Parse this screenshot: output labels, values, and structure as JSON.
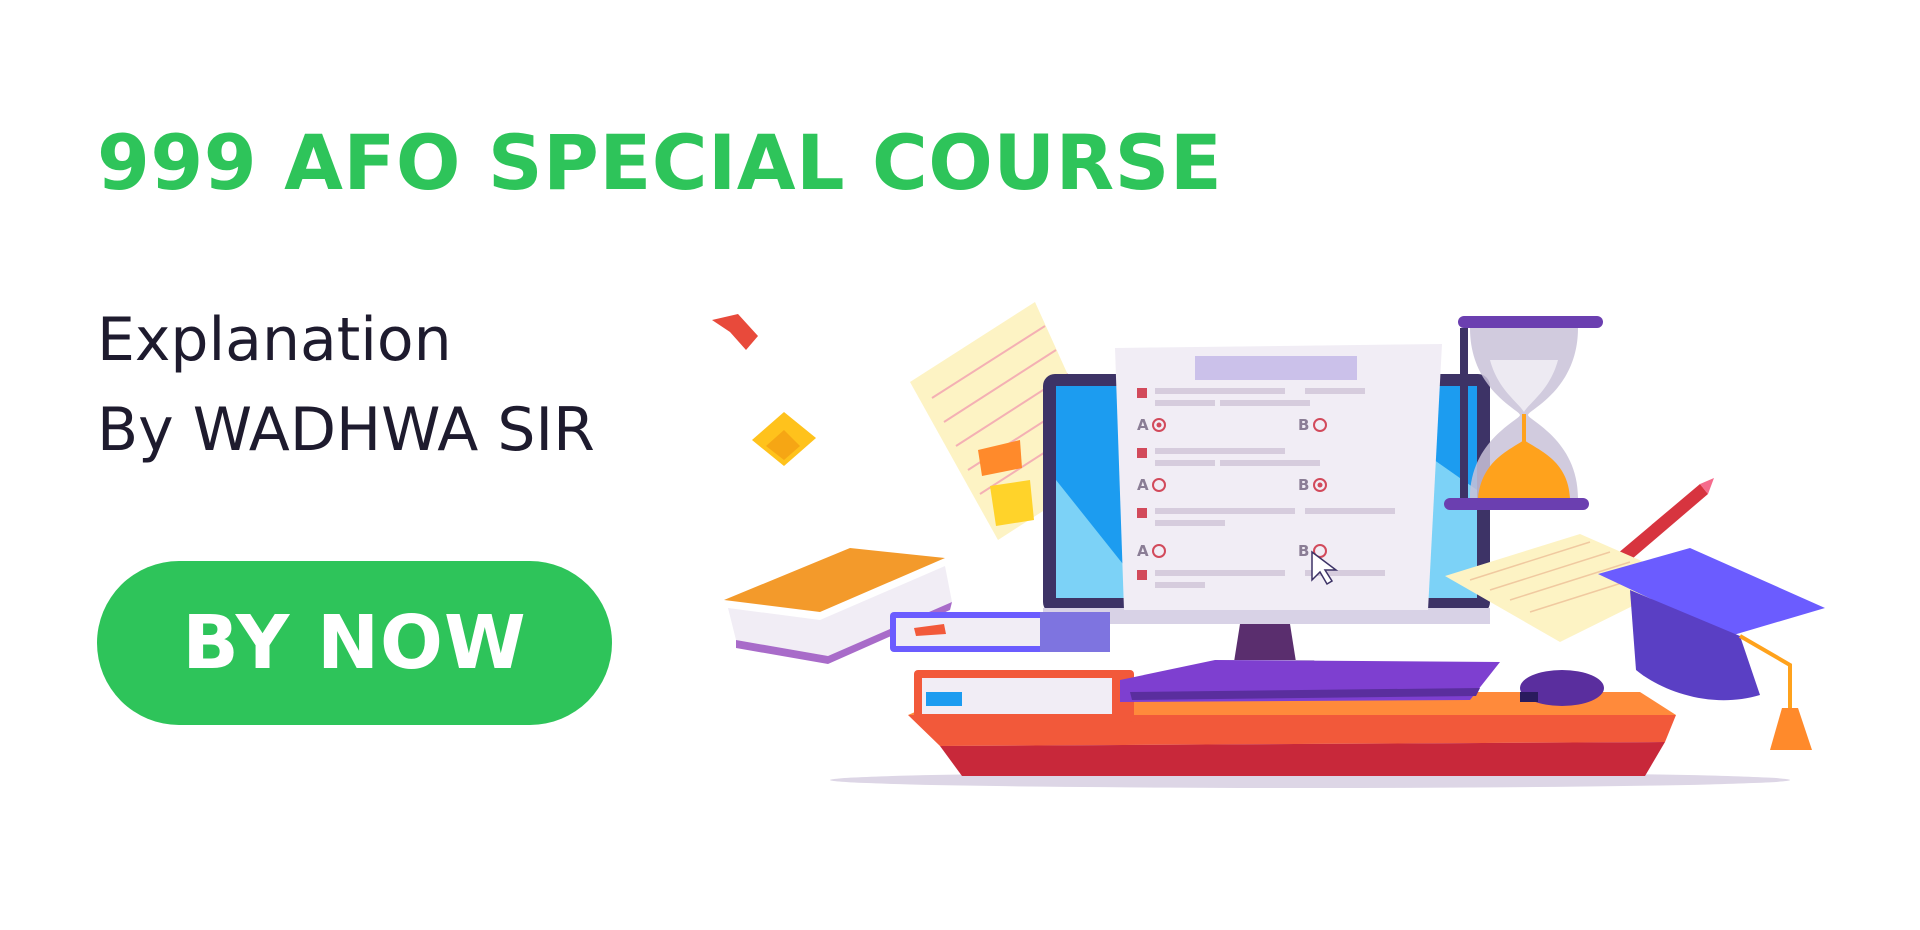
{
  "banner": {
    "title": "999 AFO SPECIAL COURSE",
    "subtitle_line1": "Explanation",
    "subtitle_line2": "By WADHWA SIR",
    "cta_label": "BY NOW"
  },
  "illustration": {
    "option_a": "A",
    "option_b": "B",
    "icons": [
      "monitor-icon",
      "hourglass-icon",
      "book-stack-icon",
      "open-book-icon",
      "graduation-cap-icon",
      "pencil-icon",
      "notepaper-icon",
      "keyboard-icon",
      "mouse-icon",
      "cursor-icon",
      "confetti-icon"
    ]
  },
  "colors": {
    "accent": "#2ec45a",
    "text": "#1e1b2e",
    "background": "#ffffff"
  }
}
